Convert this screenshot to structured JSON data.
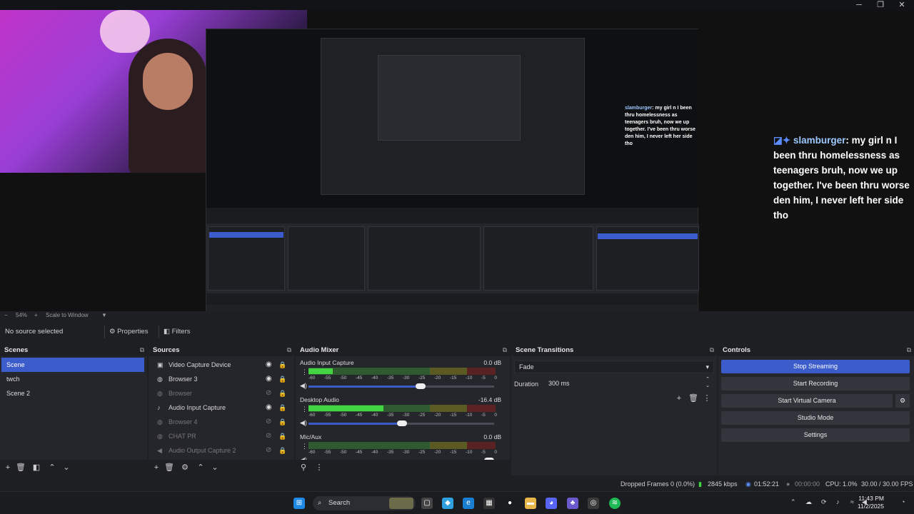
{
  "window": {
    "controls": [
      "─",
      "❐",
      "✕"
    ]
  },
  "chat": {
    "user": "slamburger",
    "message": ": my girl n I been thru homelessness as teenagers bruh, now we up together. I've been thru worse den him, I never left her side tho",
    "badge": "◪✦"
  },
  "preview_strip": {
    "zoom": "54%",
    "scale_mode": "Scale to Window"
  },
  "source_toolbar": {
    "status": "No source selected",
    "properties_label": "Properties",
    "filters_label": "Filters"
  },
  "scenes": {
    "title": "Scenes",
    "items": [
      "Scene",
      "twch",
      "Scene 2"
    ],
    "selected_index": 0
  },
  "sources": {
    "title": "Sources",
    "items": [
      {
        "label": "Video Capture Device",
        "icon": "camera-icon",
        "visible": true
      },
      {
        "label": "Browser 3",
        "icon": "globe-icon",
        "visible": true
      },
      {
        "label": "Browser",
        "icon": "globe-icon",
        "visible": false
      },
      {
        "label": "Audio Input Capture",
        "icon": "microphone-icon",
        "visible": true
      },
      {
        "label": "Browser 4",
        "icon": "globe-icon",
        "visible": false
      },
      {
        "label": "CHAT PR",
        "icon": "globe-icon",
        "visible": false
      },
      {
        "label": "Audio Output Capture 2",
        "icon": "speaker-icon",
        "visible": false
      }
    ]
  },
  "mixer": {
    "title": "Audio Mixer",
    "ticks": [
      "-60",
      "-55",
      "-50",
      "-45",
      "-40",
      "-35",
      "-30",
      "-25",
      "-20",
      "-15",
      "-10",
      "-5",
      "0"
    ],
    "channels": [
      {
        "name": "Audio Input Capture",
        "db": "0.0 dB",
        "level": 0.13,
        "volume": 0.63
      },
      {
        "name": "Desktop Audio",
        "db": "-16.4 dB",
        "level": 0.4,
        "volume": 0.53
      },
      {
        "name": "Mic/Aux",
        "db": "0.0 dB",
        "level": 0.0,
        "volume": 1.0
      }
    ]
  },
  "transitions": {
    "title": "Scene Transitions",
    "selected": "Fade",
    "duration_label": "Duration",
    "duration_value": "300 ms"
  },
  "controls": {
    "title": "Controls",
    "buttons": [
      "Stop Streaming",
      "Start Recording",
      "Start Virtual Camera",
      "Studio Mode",
      "Settings"
    ]
  },
  "statusbar": {
    "dropped": "Dropped Frames 0 (0.0%)",
    "bitrate": "2845 kbps",
    "stream_time": "01:52:21",
    "rec_time": "00:00:00",
    "cpu": "CPU: 1.0%",
    "fps": "30.00 / 30.00 FPS"
  },
  "taskbar": {
    "search_label": "Search",
    "time": "11:43 PM",
    "date": "11/2/2025"
  },
  "colors": {
    "accent": "#3c5ccc",
    "meter_green": "#43d443",
    "bg": "#25262b"
  }
}
